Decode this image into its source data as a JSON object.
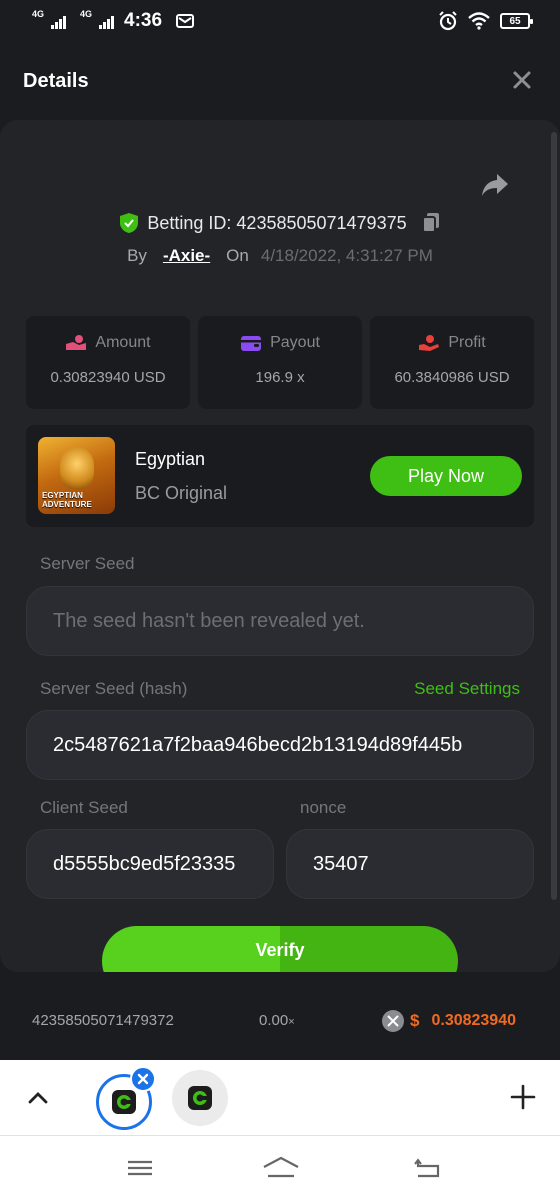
{
  "status_bar": {
    "network_1": "4G",
    "network_2": "4G",
    "time": "4:36",
    "battery": "65"
  },
  "header": {
    "title": "Details"
  },
  "bet": {
    "betting_id_label": "Betting ID:",
    "betting_id": "42358505071479375",
    "by_label": "By",
    "user": "-Axie-",
    "on_label": "On",
    "date": "4/18/2022, 4:31:27 PM"
  },
  "stats": [
    {
      "label": "Amount",
      "value": "0.30823940 USD",
      "icon": "amount-icon",
      "color": "#e0507a"
    },
    {
      "label": "Payout",
      "value": "196.9 x",
      "icon": "wallet-icon",
      "color": "#8a4bf0"
    },
    {
      "label": "Profit",
      "value": "60.3840986 USD",
      "icon": "profit-hand-icon",
      "color": "#e8403a"
    }
  ],
  "game": {
    "name": "Egyptian",
    "subtitle": "BC Original",
    "thumb_text_1": "EGYPTIAN",
    "thumb_text_2": "ADVENTURE",
    "play_label": "Play Now"
  },
  "seeds": {
    "server_seed_label": "Server Seed",
    "server_seed_placeholder": "The seed hasn't been revealed yet.",
    "server_hash_label": "Server Seed (hash)",
    "seed_settings_label": "Seed Settings",
    "server_hash_value": "2c5487621a7f2baa946becd2b13194d89f445b",
    "client_seed_label": "Client Seed",
    "client_seed_value": "d5555bc9ed5f23335",
    "nonce_label": "nonce",
    "nonce_value": "35407",
    "verify_label": "Verify"
  },
  "history": {
    "id": "42358505071479372",
    "multiplier": "0.00",
    "multiplier_suffix": "×",
    "currency_symbol": "$",
    "amount": "0.30823940"
  },
  "colors": {
    "accent_green": "#3fbf14",
    "orange": "#f26a21",
    "tab_blue": "#1a73e8"
  }
}
